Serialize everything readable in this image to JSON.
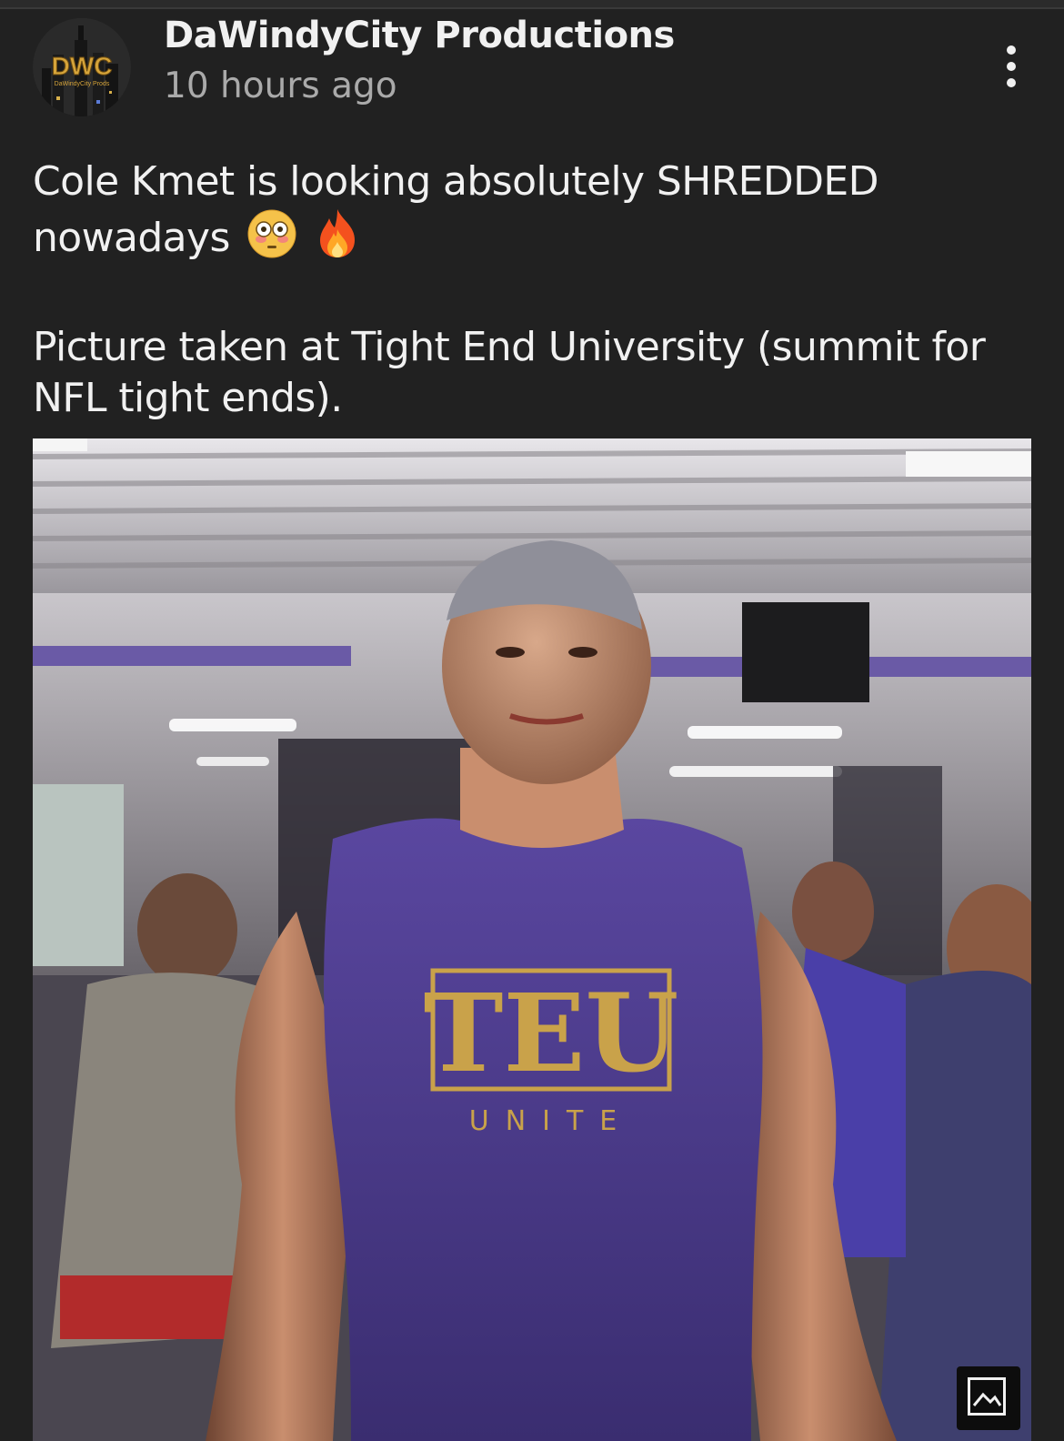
{
  "post": {
    "channel_name": "DaWindyCity Productions",
    "timestamp": "10 hours ago",
    "avatar_text": "DWC",
    "avatar_subtext": "DaWindyCity Prods",
    "text_line1": "Cole Kmet is looking absolutely SHREDDED",
    "text_line2": "nowadays",
    "text_line3": "Picture taken at Tight End University (summit for",
    "text_line4": "NFL tight ends).",
    "emojis": [
      "flushed-face",
      "fire"
    ]
  },
  "photo": {
    "shirt_logo": "TEU",
    "shirt_sub": "UNITE",
    "colors": {
      "shirt": "#4b3a8c",
      "logo": "#c9a24a",
      "gym_purple": "#6a5aa6"
    }
  },
  "icons": {
    "more": "vertical-ellipsis-icon",
    "image_badge": "image-icon"
  }
}
